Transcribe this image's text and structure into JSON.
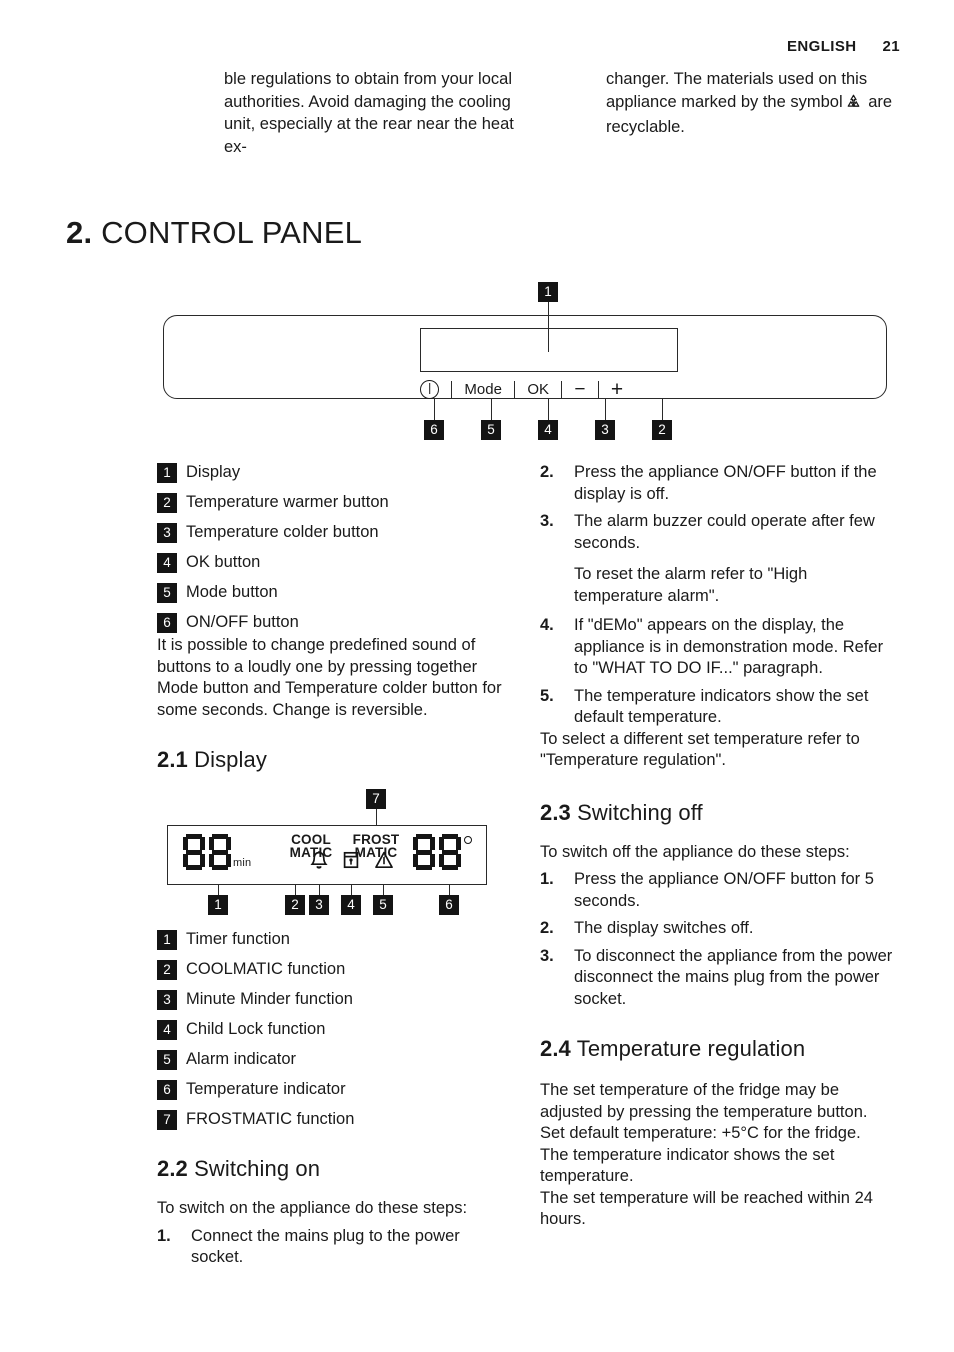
{
  "header": {
    "language": "ENGLISH",
    "page_number": "21"
  },
  "intro": {
    "left": "ble regulations to obtain from your local authorities. Avoid damaging the cooling unit, especially at the rear near the heat ex-",
    "right_before": "changer. The materials used on this appliance marked by the symbol",
    "right_after": "are recyclable.",
    "recycle_icon": "recycle-icon"
  },
  "chapter": {
    "number": "2.",
    "title": "CONTROL PANEL"
  },
  "control_panel_figure": {
    "display_badge": "1",
    "buttons": [
      {
        "badge": "6",
        "label": "",
        "icon": "power-icon"
      },
      {
        "badge": "5",
        "label": "Mode",
        "icon": ""
      },
      {
        "badge": "4",
        "label": "OK",
        "icon": ""
      },
      {
        "badge": "3",
        "label": "−",
        "icon": "minus-icon"
      },
      {
        "badge": "2",
        "label": "+",
        "icon": "plus-icon"
      }
    ]
  },
  "panel_key": [
    {
      "num": "1",
      "label": "Display"
    },
    {
      "num": "2",
      "label": "Temperature warmer button"
    },
    {
      "num": "3",
      "label": "Temperature colder button"
    },
    {
      "num": "4",
      "label": "OK button"
    },
    {
      "num": "5",
      "label": "Mode button"
    },
    {
      "num": "6",
      "label": "ON/OFF button"
    }
  ],
  "panel_note": "It is possible to change predefined sound of buttons to a loudly one by pressing together Mode button and Temperature colder button for some seconds. Change is reversible.",
  "switch_on_continued": {
    "steps": [
      {
        "num": "2.",
        "text": "Press the appliance ON/OFF button if the display is off."
      },
      {
        "num": "3.",
        "text": "The alarm buzzer could operate after few seconds."
      },
      {
        "num": "4.",
        "text": "If \"dEMo\" appears on the display, the appliance is in demonstration mode. Refer to \"WHAT TO DO IF...\" paragraph."
      },
      {
        "num": "5.",
        "text": "The temperature indicators show the set default temperature."
      }
    ],
    "note_after_step3": "To reset the alarm refer to \"High temperature alarm\".",
    "closing": "To select a different set temperature refer to \"Temperature regulation\"."
  },
  "display_section": {
    "heading_num": "2.1",
    "heading_title": "Display",
    "figure": {
      "left_digits": "88",
      "left_unit": "min",
      "coolmatic_line1": "COOL",
      "coolmatic_line2": "MATIC",
      "frostmatic_line1": "FROST",
      "frostmatic_line2": "MATIC",
      "right_digits": "88",
      "degree_symbol": "°",
      "badges": [
        "1",
        "2",
        "3",
        "4",
        "5",
        "6",
        "7"
      ],
      "icons": [
        "bell-icon",
        "child-lock-icon",
        "warning-triangle-icon"
      ]
    },
    "key": [
      {
        "num": "1",
        "label": "Timer function"
      },
      {
        "num": "2",
        "label": "COOLMATIC function"
      },
      {
        "num": "3",
        "label": "Minute Minder function"
      },
      {
        "num": "4",
        "label": "Child Lock function"
      },
      {
        "num": "5",
        "label": "Alarm indicator"
      },
      {
        "num": "6",
        "label": "Temperature indicator"
      },
      {
        "num": "7",
        "label": "FROSTMATIC function"
      }
    ]
  },
  "switching_on": {
    "heading_num": "2.2",
    "heading_title": "Switching on",
    "intro": "To switch on the appliance do these steps:",
    "steps": [
      {
        "num": "1.",
        "text": "Connect the mains plug to the power socket."
      }
    ]
  },
  "switching_off": {
    "heading_num": "2.3",
    "heading_title": "Switching off",
    "intro": "To switch off the appliance do these steps:",
    "steps": [
      {
        "num": "1.",
        "text": "Press the appliance ON/OFF button for 5 seconds."
      },
      {
        "num": "2.",
        "text": "The display switches off."
      },
      {
        "num": "3.",
        "text": "To disconnect the appliance from the power disconnect the mains plug from the power socket."
      }
    ]
  },
  "temperature_regulation": {
    "heading_num": "2.4",
    "heading_title": "Temperature regulation",
    "paragraphs": [
      "The set temperature of the fridge may be adjusted by pressing the temperature button.",
      "Set default temperature: +5°C for the fridge.",
      "The temperature indicator shows the set temperature.",
      "The set temperature will be reached within 24 hours."
    ]
  }
}
